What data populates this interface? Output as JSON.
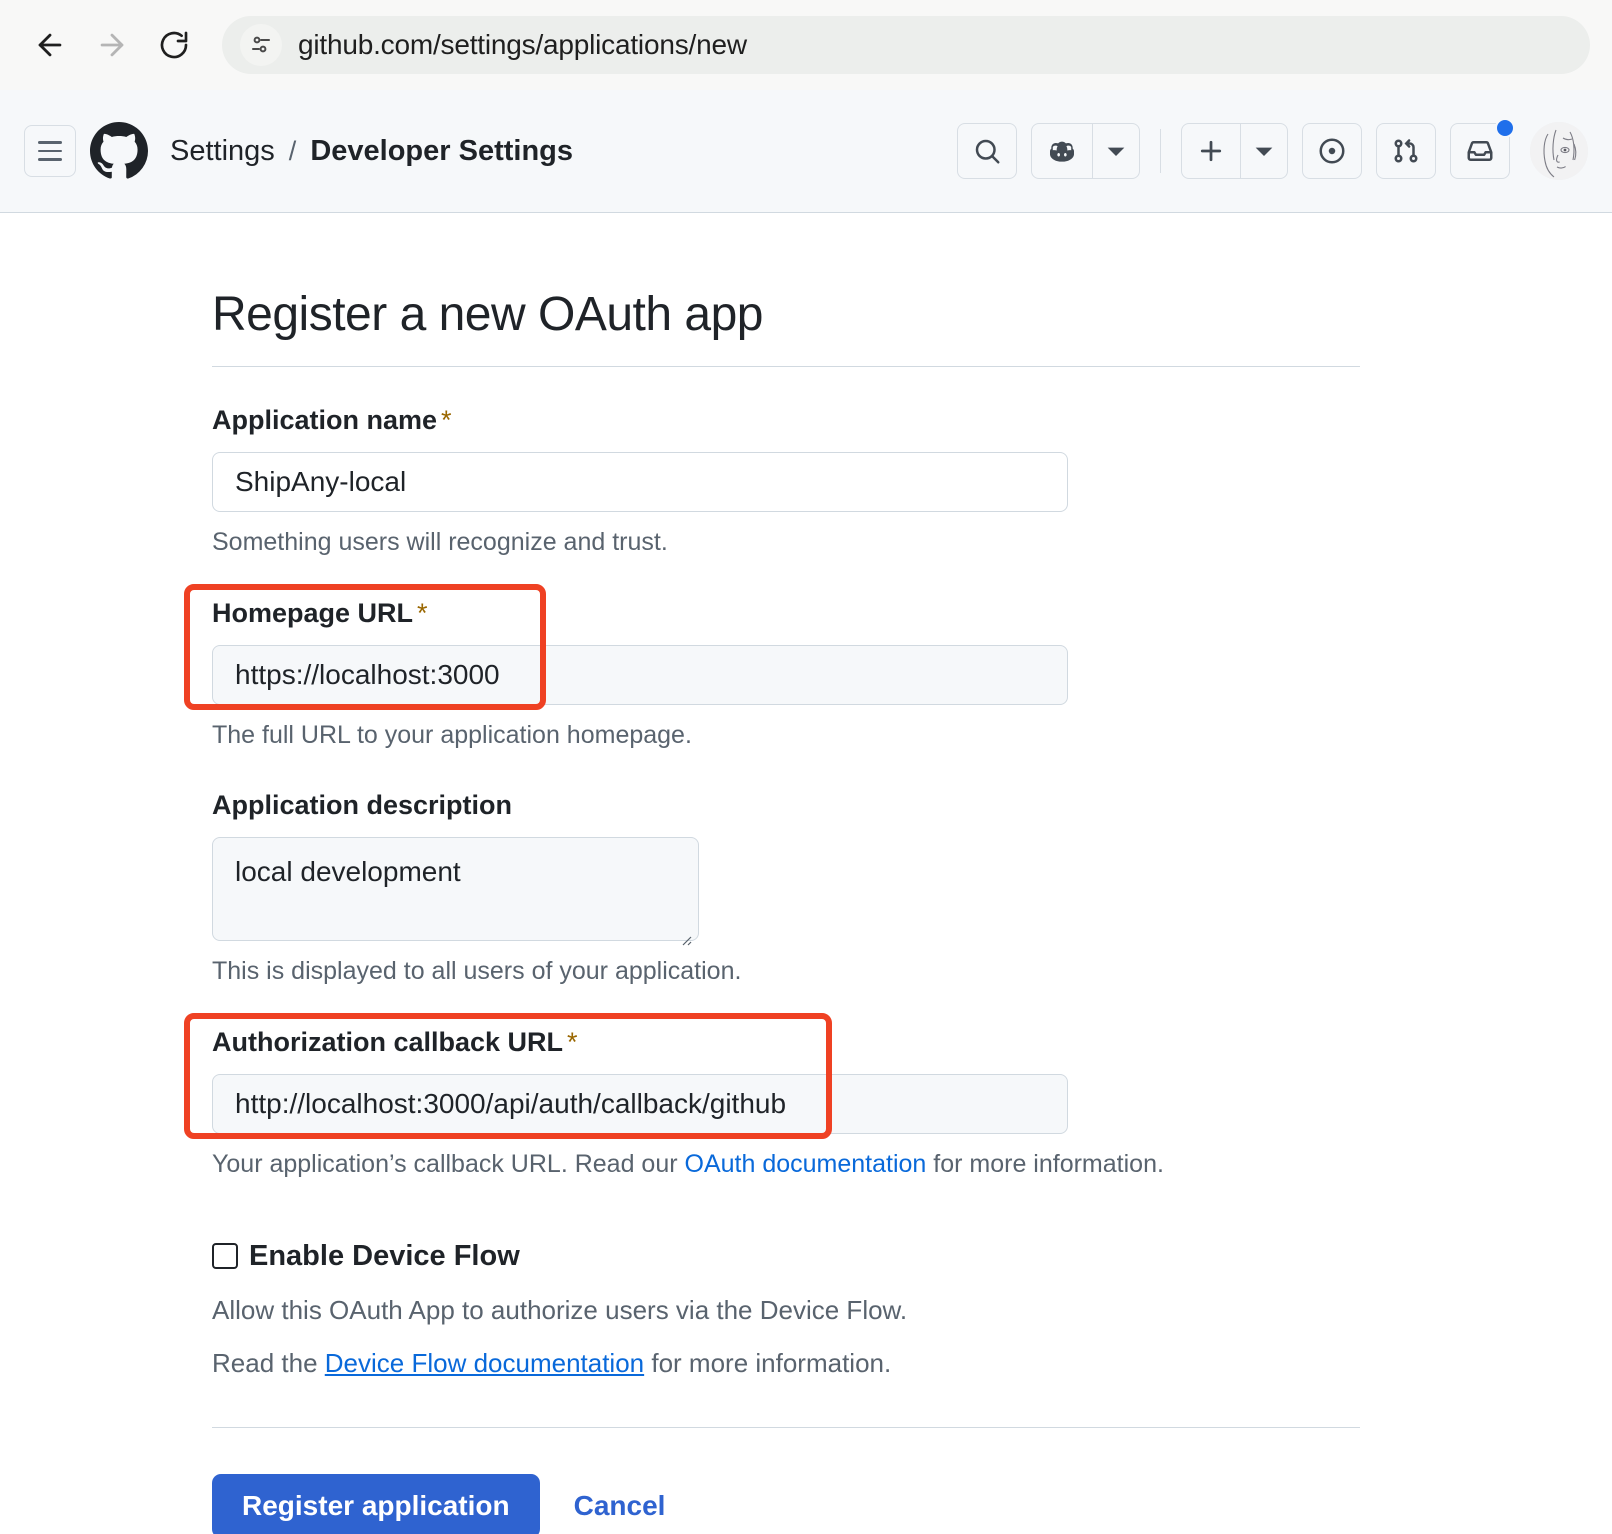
{
  "browser": {
    "url": "github.com/settings/applications/new",
    "back_icon": "back-arrow-icon",
    "forward_icon": "forward-arrow-icon",
    "reload_icon": "reload-icon",
    "site_info_icon": "site-settings-icon"
  },
  "header": {
    "menu_icon": "hamburger-menu-icon",
    "logo_icon": "github-logo-icon",
    "breadcrumb": {
      "root": "Settings",
      "separator": "/",
      "current": "Developer Settings"
    },
    "actions": {
      "search_icon": "search-icon",
      "copilot_icon": "copilot-icon",
      "copilot_caret_icon": "chevron-down-icon",
      "plus_icon": "plus-icon",
      "plus_caret_icon": "chevron-down-icon",
      "issues_icon": "issue-opened-icon",
      "pull_requests_icon": "git-pull-request-icon",
      "inbox_icon": "inbox-icon",
      "notification_dot_color": "#1f6feb",
      "avatar_icon": "user-avatar"
    }
  },
  "page": {
    "title": "Register a new OAuth app",
    "fields": {
      "app_name": {
        "label": "Application name",
        "required_marker": "*",
        "value": "ShipAny-local",
        "hint": "Something users will recognize and trust."
      },
      "homepage_url": {
        "label": "Homepage URL",
        "required_marker": "*",
        "value": "https://localhost:3000",
        "hint": "The full URL to your application homepage.",
        "highlighted": true
      },
      "app_description": {
        "label": "Application description",
        "required_marker": "",
        "value": "local development",
        "hint": "This is displayed to all users of your application."
      },
      "callback_url": {
        "label": "Authorization callback URL",
        "required_marker": "*",
        "value": "http://localhost:3000/api/auth/callback/github",
        "hint_before": "Your application’s callback URL. Read our ",
        "hint_link": "OAuth documentation",
        "hint_after": " for more information.",
        "highlighted": true
      }
    },
    "device_flow": {
      "checkbox_checked": false,
      "label": "Enable Device Flow",
      "description": "Allow this OAuth App to authorize users via the Device Flow.",
      "read_before": "Read the ",
      "read_link": "Device Flow documentation",
      "read_after": " for more information."
    },
    "actions": {
      "submit_label": "Register application",
      "cancel_label": "Cancel",
      "submit_color": "#2f63d0"
    }
  },
  "annotations": {
    "color": "#ef4123",
    "boxes": [
      "homepage-url-highlight",
      "callback-url-highlight"
    ]
  }
}
